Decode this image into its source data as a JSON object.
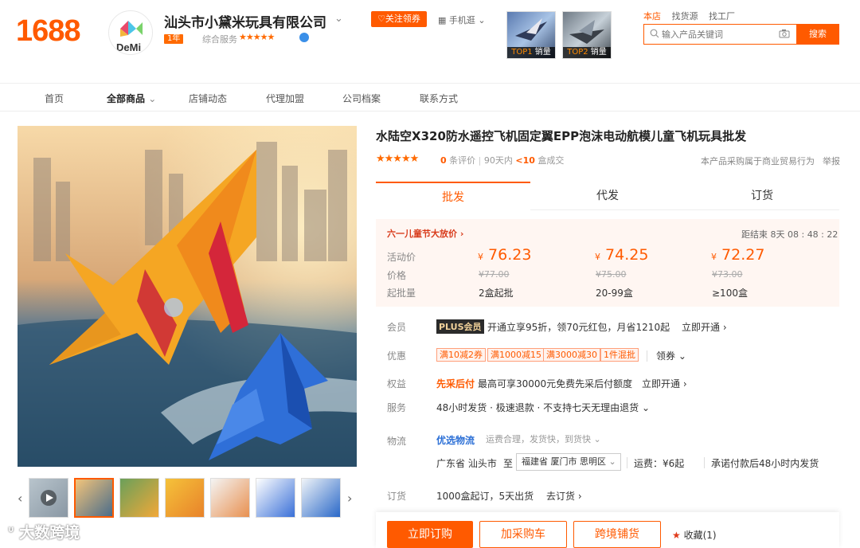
{
  "header": {
    "logo": "1688",
    "shop_name": "汕头市小黛米玩具有限公司",
    "shop_logo_text": "DeMi",
    "year_badge": "1年",
    "service_label": "综合服务",
    "service_stars": "★★★★★",
    "follow_button": "♡关注领券",
    "mobile_label": "手机逛",
    "top_items": [
      {
        "rank": "TOP1",
        "label": "销量"
      },
      {
        "rank": "TOP2",
        "label": "销量"
      }
    ],
    "search_links": [
      "本店",
      "找货源",
      "找工厂"
    ],
    "search_placeholder": "输入产品关键词",
    "search_button": "搜索"
  },
  "nav": {
    "items": [
      "首页",
      "全部商品",
      "店铺动态",
      "代理加盟",
      "公司档案",
      "联系方式"
    ]
  },
  "gallery": {
    "watermark": "大数跨境"
  },
  "product": {
    "title": "水陆空X320防水遥控飞机固定翼EPP泡沫电动航模儿童飞机玩具批发",
    "rating_stars": "★★★★★",
    "review_count": "0",
    "review_label": "条评价",
    "sold_prefix": "90天内",
    "sold_value": "<10",
    "sold_suffix": "盒成交",
    "trade_note": "本产品采购属于商业贸易行为",
    "report": "举报",
    "tabs": [
      "批发",
      "代发",
      "订货"
    ],
    "promo_label": "六一儿童节大放价 ›",
    "countdown": "距结束 8天 08 : 48 : 22",
    "row_labels": {
      "active": "活动价",
      "price": "价格",
      "moq": "起批量"
    },
    "tiers": [
      {
        "active": "76.23",
        "original": "¥77.00",
        "qty": "2盒起批"
      },
      {
        "active": "74.25",
        "original": "¥75.00",
        "qty": "20-99盒"
      },
      {
        "active": "72.27",
        "original": "¥73.00",
        "qty": "≥100盒"
      }
    ],
    "currency": "¥",
    "member": {
      "label": "会员",
      "badge": "PLUS会员",
      "text": "开通立享95折，领70元红包，月省1210起",
      "link": "立即开通 ›"
    },
    "discount": {
      "label": "优惠",
      "coupons": [
        "满10减2券",
        "满1000减15",
        "满3000减30",
        "1件混批"
      ],
      "link": "领券 ⌄"
    },
    "benefit": {
      "label": "权益",
      "highlight": "先采后付",
      "text": "最高可享30000元免费先采后付额度",
      "link": "立即开通 ›"
    },
    "service": {
      "label": "服务",
      "text": "48小时发货 · 极速退款 · 不支持七天无理由退货 ⌄"
    },
    "logistics": {
      "label": "物流",
      "tag": "优选物流",
      "tag_note": "运费合理，发货快，到货快 ⌄",
      "from": "广东省 汕头市",
      "to_label": "至",
      "to": "福建省 厦门市 思明区",
      "freight": "运费：¥6起",
      "promise": "承诺付款后48小时内发货"
    },
    "order": {
      "label": "订货",
      "text": "1000盒起订，5天出货",
      "link": "去订货 ›"
    },
    "buttons": {
      "buy": "立即订购",
      "cart": "加采购车",
      "crossborder": "跨境铺货",
      "favorite": "收藏(1)"
    }
  }
}
